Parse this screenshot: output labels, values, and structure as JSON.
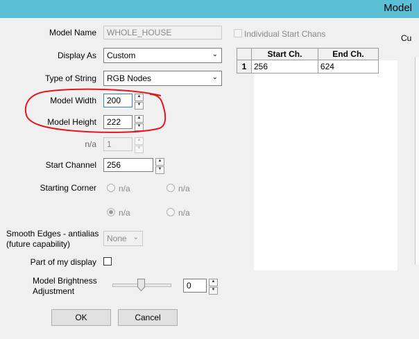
{
  "window": {
    "title": "Model"
  },
  "right_panel": {
    "label": "Cu"
  },
  "form": {
    "model_name": {
      "label": "Model Name",
      "value": "WHOLE_HOUSE"
    },
    "display_as": {
      "label": "Display As",
      "value": "Custom"
    },
    "type_of_string": {
      "label": "Type of String",
      "value": "RGB Nodes"
    },
    "model_width": {
      "label": "Model Width",
      "value": "200"
    },
    "model_height": {
      "label": "Model Height",
      "value": "222"
    },
    "na_field": {
      "label": "n/a",
      "value": "1"
    },
    "start_channel": {
      "label": "Start Channel",
      "value": "256"
    },
    "starting_corner": {
      "label": "Starting Corner",
      "options": [
        "n/a",
        "n/a",
        "n/a",
        "n/a"
      ],
      "selected_index": 2
    },
    "smooth_edges": {
      "label_line1": "Smooth Edges - antialias",
      "label_line2": "(future capability)",
      "value": "None"
    },
    "part_of_display": {
      "label": "Part of my display",
      "checked": false
    },
    "brightness": {
      "label_line1": "Model Brightness",
      "label_line2": "Adjustment",
      "value": "0"
    }
  },
  "individual_start_chans": {
    "label": "Individual Start Chans",
    "checked": false
  },
  "channels_table": {
    "columns": [
      "Start Ch.",
      "End Ch."
    ],
    "rows": [
      {
        "index": "1",
        "start": "256",
        "end": "624"
      }
    ]
  },
  "buttons": {
    "ok": "OK",
    "cancel": "Cancel"
  },
  "annotation": {
    "color": "#e8141c"
  }
}
